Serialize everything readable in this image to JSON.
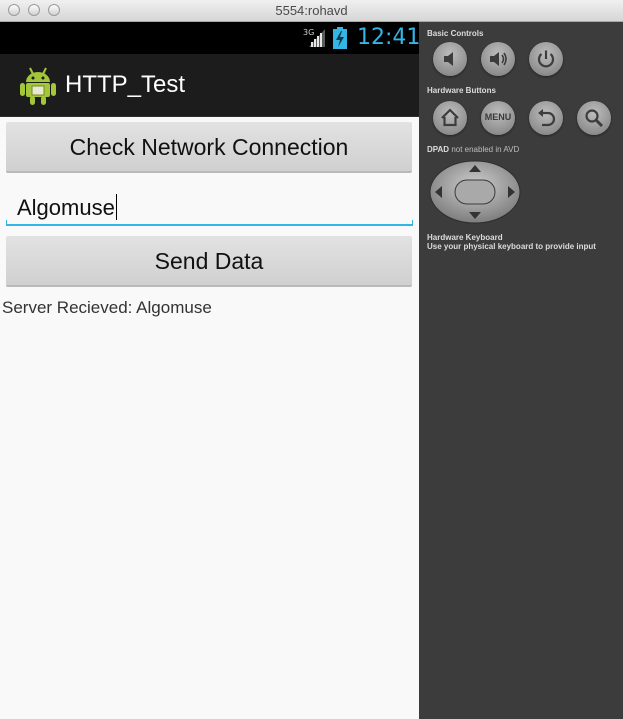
{
  "window": {
    "title": "5554:rohavd"
  },
  "statusbar": {
    "network": "3G",
    "time": "12:41"
  },
  "actionbar": {
    "title": "HTTP_Test"
  },
  "main": {
    "check_button_label": "Check Network Connection",
    "input_value": "Algomuse",
    "send_button_label": "Send Data",
    "result_text": "Server Recieved: Algomuse"
  },
  "panel": {
    "basic_controls_label": "Basic Controls",
    "hardware_buttons_label": "Hardware Buttons",
    "menu_label": "MENU",
    "dpad_label": "DPAD",
    "dpad_note": "not enabled in AVD",
    "keyboard_label": "Hardware Keyboard",
    "keyboard_note": "Use your physical keyboard to provide input"
  },
  "colors": {
    "accent": "#33b5e5",
    "panel_bg": "#3c3c3c",
    "actionbar_bg": "#1c1c1c"
  }
}
